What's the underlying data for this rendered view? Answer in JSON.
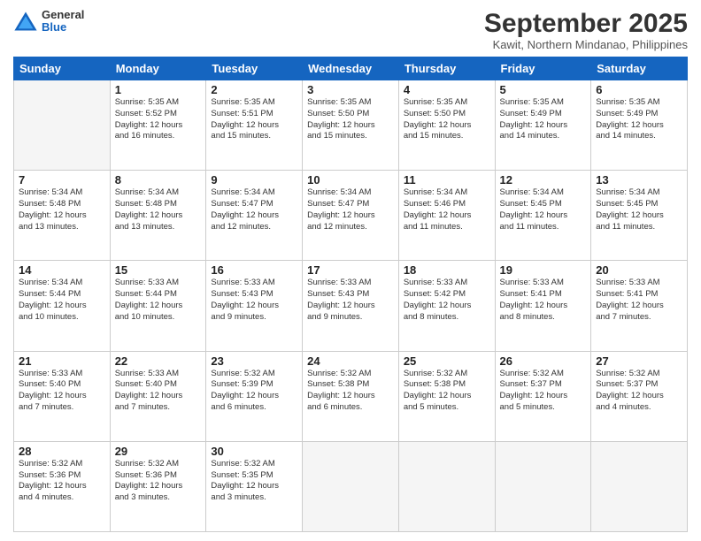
{
  "logo": {
    "general": "General",
    "blue": "Blue"
  },
  "title": "September 2025",
  "subtitle": "Kawit, Northern Mindanao, Philippines",
  "days": [
    "Sunday",
    "Monday",
    "Tuesday",
    "Wednesday",
    "Thursday",
    "Friday",
    "Saturday"
  ],
  "weeks": [
    [
      {
        "num": "",
        "info": ""
      },
      {
        "num": "1",
        "info": "Sunrise: 5:35 AM\nSunset: 5:52 PM\nDaylight: 12 hours\nand 16 minutes."
      },
      {
        "num": "2",
        "info": "Sunrise: 5:35 AM\nSunset: 5:51 PM\nDaylight: 12 hours\nand 15 minutes."
      },
      {
        "num": "3",
        "info": "Sunrise: 5:35 AM\nSunset: 5:50 PM\nDaylight: 12 hours\nand 15 minutes."
      },
      {
        "num": "4",
        "info": "Sunrise: 5:35 AM\nSunset: 5:50 PM\nDaylight: 12 hours\nand 15 minutes."
      },
      {
        "num": "5",
        "info": "Sunrise: 5:35 AM\nSunset: 5:49 PM\nDaylight: 12 hours\nand 14 minutes."
      },
      {
        "num": "6",
        "info": "Sunrise: 5:35 AM\nSunset: 5:49 PM\nDaylight: 12 hours\nand 14 minutes."
      }
    ],
    [
      {
        "num": "7",
        "info": "Sunrise: 5:34 AM\nSunset: 5:48 PM\nDaylight: 12 hours\nand 13 minutes."
      },
      {
        "num": "8",
        "info": "Sunrise: 5:34 AM\nSunset: 5:48 PM\nDaylight: 12 hours\nand 13 minutes."
      },
      {
        "num": "9",
        "info": "Sunrise: 5:34 AM\nSunset: 5:47 PM\nDaylight: 12 hours\nand 12 minutes."
      },
      {
        "num": "10",
        "info": "Sunrise: 5:34 AM\nSunset: 5:47 PM\nDaylight: 12 hours\nand 12 minutes."
      },
      {
        "num": "11",
        "info": "Sunrise: 5:34 AM\nSunset: 5:46 PM\nDaylight: 12 hours\nand 11 minutes."
      },
      {
        "num": "12",
        "info": "Sunrise: 5:34 AM\nSunset: 5:45 PM\nDaylight: 12 hours\nand 11 minutes."
      },
      {
        "num": "13",
        "info": "Sunrise: 5:34 AM\nSunset: 5:45 PM\nDaylight: 12 hours\nand 11 minutes."
      }
    ],
    [
      {
        "num": "14",
        "info": "Sunrise: 5:34 AM\nSunset: 5:44 PM\nDaylight: 12 hours\nand 10 minutes."
      },
      {
        "num": "15",
        "info": "Sunrise: 5:33 AM\nSunset: 5:44 PM\nDaylight: 12 hours\nand 10 minutes."
      },
      {
        "num": "16",
        "info": "Sunrise: 5:33 AM\nSunset: 5:43 PM\nDaylight: 12 hours\nand 9 minutes."
      },
      {
        "num": "17",
        "info": "Sunrise: 5:33 AM\nSunset: 5:43 PM\nDaylight: 12 hours\nand 9 minutes."
      },
      {
        "num": "18",
        "info": "Sunrise: 5:33 AM\nSunset: 5:42 PM\nDaylight: 12 hours\nand 8 minutes."
      },
      {
        "num": "19",
        "info": "Sunrise: 5:33 AM\nSunset: 5:41 PM\nDaylight: 12 hours\nand 8 minutes."
      },
      {
        "num": "20",
        "info": "Sunrise: 5:33 AM\nSunset: 5:41 PM\nDaylight: 12 hours\nand 7 minutes."
      }
    ],
    [
      {
        "num": "21",
        "info": "Sunrise: 5:33 AM\nSunset: 5:40 PM\nDaylight: 12 hours\nand 7 minutes."
      },
      {
        "num": "22",
        "info": "Sunrise: 5:33 AM\nSunset: 5:40 PM\nDaylight: 12 hours\nand 7 minutes."
      },
      {
        "num": "23",
        "info": "Sunrise: 5:32 AM\nSunset: 5:39 PM\nDaylight: 12 hours\nand 6 minutes."
      },
      {
        "num": "24",
        "info": "Sunrise: 5:32 AM\nSunset: 5:38 PM\nDaylight: 12 hours\nand 6 minutes."
      },
      {
        "num": "25",
        "info": "Sunrise: 5:32 AM\nSunset: 5:38 PM\nDaylight: 12 hours\nand 5 minutes."
      },
      {
        "num": "26",
        "info": "Sunrise: 5:32 AM\nSunset: 5:37 PM\nDaylight: 12 hours\nand 5 minutes."
      },
      {
        "num": "27",
        "info": "Sunrise: 5:32 AM\nSunset: 5:37 PM\nDaylight: 12 hours\nand 4 minutes."
      }
    ],
    [
      {
        "num": "28",
        "info": "Sunrise: 5:32 AM\nSunset: 5:36 PM\nDaylight: 12 hours\nand 4 minutes."
      },
      {
        "num": "29",
        "info": "Sunrise: 5:32 AM\nSunset: 5:36 PM\nDaylight: 12 hours\nand 3 minutes."
      },
      {
        "num": "30",
        "info": "Sunrise: 5:32 AM\nSunset: 5:35 PM\nDaylight: 12 hours\nand 3 minutes."
      },
      {
        "num": "",
        "info": ""
      },
      {
        "num": "",
        "info": ""
      },
      {
        "num": "",
        "info": ""
      },
      {
        "num": "",
        "info": ""
      }
    ]
  ]
}
